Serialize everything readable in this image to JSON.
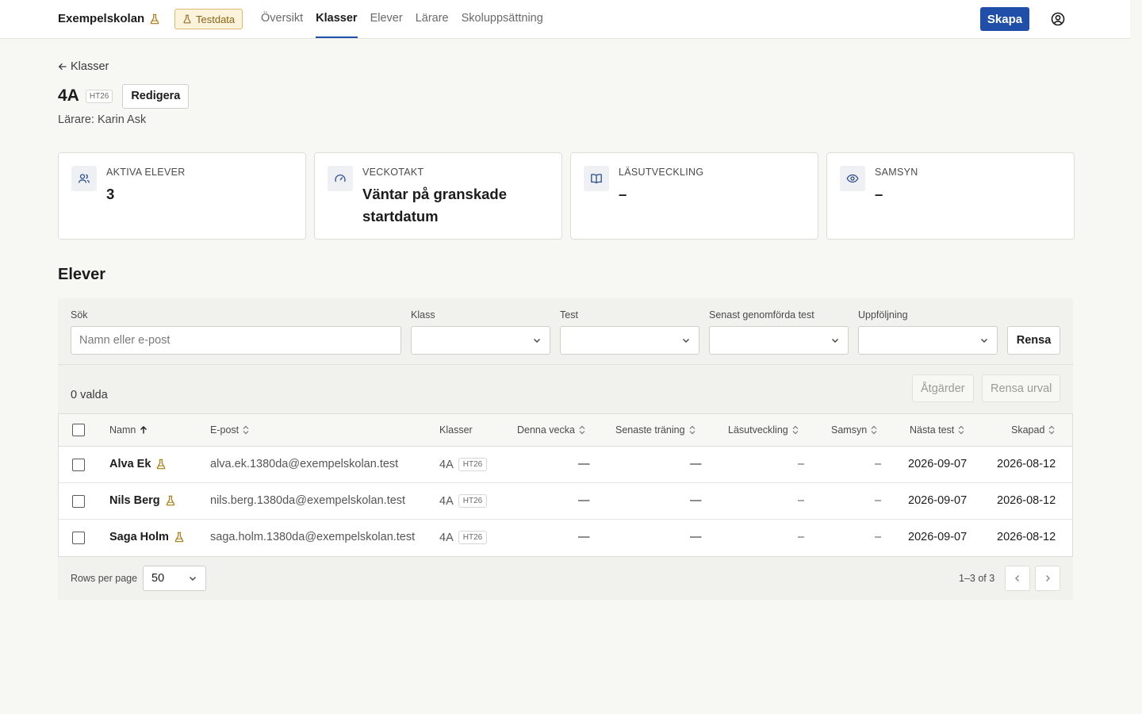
{
  "header": {
    "brand": "Exempelskolan",
    "testdata_label": "Testdata",
    "nav": [
      "Översikt",
      "Klasser",
      "Elever",
      "Lärare",
      "Skoluppsättning"
    ],
    "active_nav": "Klasser",
    "create_label": "Skapa",
    "accent_color": "#1f4fa8"
  },
  "breadcrumb": {
    "back_label": "Klasser"
  },
  "class": {
    "name": "4A",
    "term": "HT26",
    "edit_label": "Redigera",
    "teacher": "Lärare: Karin Ask"
  },
  "stats": [
    {
      "icon": "users-icon",
      "label": "Aktiva elever",
      "value": "3"
    },
    {
      "icon": "gauge-icon",
      "label": "Veckotakt",
      "value": "Väntar på granskade startdatum"
    },
    {
      "icon": "book-icon",
      "label": "Läsutveckling",
      "value": "–"
    },
    {
      "icon": "eye-icon",
      "label": "Samsyn",
      "value": "–"
    }
  ],
  "students_section": {
    "title": "Elever",
    "filters": {
      "search_label": "Sök",
      "search_placeholder": "Namn eller e-post",
      "class_label": "Klass",
      "test_label": "Test",
      "latest_label": "Senast genomförda test",
      "followup_label": "Uppföljning",
      "clear_label": "Rensa"
    },
    "selection": {
      "count": "0 valda",
      "actions_label": "Åtgärder",
      "clear_selection_label": "Rensa urval"
    },
    "columns": [
      "Namn",
      "E-post",
      "Klasser",
      "Denna vecka",
      "Senaste träning",
      "Läsutveckling",
      "Samsyn",
      "Nästa test",
      "Skapad"
    ],
    "rows": [
      {
        "name": "Alva Ek",
        "email": "alva.ek.1380da@exempelskolan.test",
        "class": "4A",
        "term": "HT26",
        "week": "—",
        "training": "—",
        "reading": "–",
        "samsyn": "–",
        "next_test": "2026-09-07",
        "created": "2026-08-12"
      },
      {
        "name": "Nils Berg",
        "email": "nils.berg.1380da@exempelskolan.test",
        "class": "4A",
        "term": "HT26",
        "week": "—",
        "training": "—",
        "reading": "–",
        "samsyn": "–",
        "next_test": "2026-09-07",
        "created": "2026-08-12"
      },
      {
        "name": "Saga Holm",
        "email": "saga.holm.1380da@exempelskolan.test",
        "class": "4A",
        "term": "HT26",
        "week": "—",
        "training": "—",
        "reading": "–",
        "samsyn": "–",
        "next_test": "2026-09-07",
        "created": "2026-08-12"
      }
    ],
    "pagination": {
      "rows_per_page_label": "Rows per page",
      "rows_per_page": "50",
      "range": "1–3 of 3"
    }
  }
}
